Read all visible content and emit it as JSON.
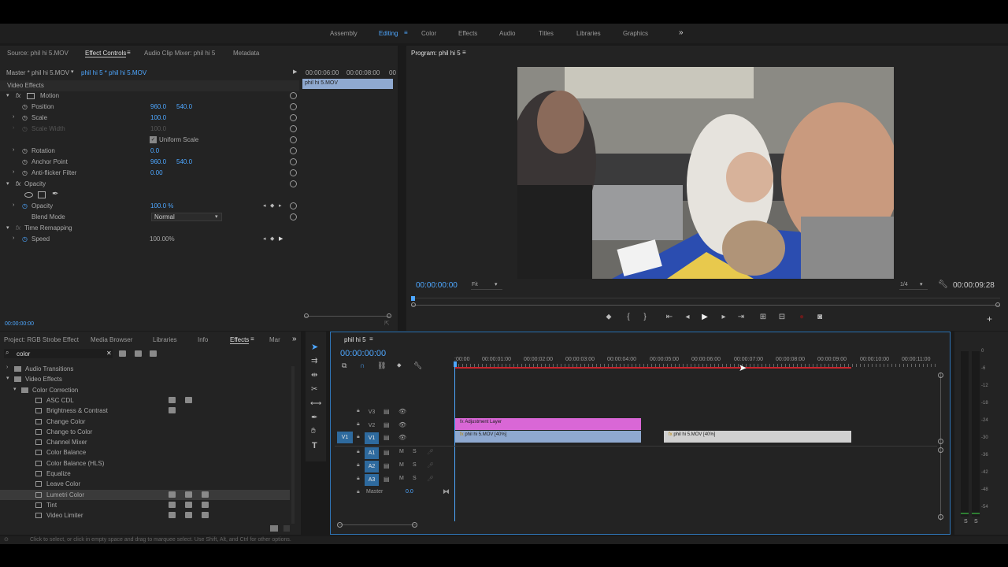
{
  "workspaces": {
    "items": [
      "Assembly",
      "Editing",
      "Color",
      "Effects",
      "Audio",
      "Titles",
      "Libraries",
      "Graphics"
    ],
    "active": "Editing",
    "more": "»"
  },
  "source_panel": {
    "tabs": [
      "Source: phil hi 5.MOV",
      "Effect Controls",
      "Audio Clip Mixer: phil hi 5",
      "Metadata"
    ],
    "master": "Master * phil hi 5.MOV",
    "sequence_clip": "phil hi 5 * phil hi 5.MOV",
    "ruler": [
      "00:00:06:00",
      "00:00:08:00",
      "00"
    ],
    "clip_label": "phil hi 5.MOV",
    "section": "Video Effects",
    "motion": "Motion",
    "position_label": "Position",
    "position_x": "960.0",
    "position_y": "540.0",
    "scale_label": "Scale",
    "scale": "100.0",
    "scale_width_label": "Scale Width",
    "scale_width": "100.0",
    "uniform_scale": "Uniform Scale",
    "rotation_label": "Rotation",
    "rotation": "0.0",
    "anchor_label": "Anchor Point",
    "anchor_x": "960.0",
    "anchor_y": "540.0",
    "antiflicker_label": "Anti-flicker Filter",
    "antiflicker": "0.00",
    "opacity_section": "Opacity",
    "opacity_label": "Opacity",
    "opacity": "100.0 %",
    "blend_label": "Blend Mode",
    "blend": "Normal",
    "time_remap": "Time Remapping",
    "speed_label": "Speed",
    "speed": "100.00%",
    "timecode": "00:00:00:00"
  },
  "program": {
    "title": "Program: phil hi 5",
    "timecode": "00:00:00:00",
    "fit": "Fit",
    "quality": "1/4",
    "duration": "00:00:09:28"
  },
  "project_panel": {
    "tabs": [
      "Project: RGB Strobe Effect",
      "Media Browser",
      "Libraries",
      "Info",
      "Effects",
      "Mar"
    ],
    "active_tab": "Effects",
    "more": "»",
    "search_value": "color",
    "tree": [
      {
        "label": "Audio Transitions",
        "type": "folder",
        "indent": 0,
        "expanded": false
      },
      {
        "label": "Video Effects",
        "type": "folder",
        "indent": 0,
        "expanded": true
      },
      {
        "label": "Color Correction",
        "type": "folder",
        "indent": 1,
        "expanded": true
      },
      {
        "label": "ASC CDL",
        "type": "fx",
        "indent": 2,
        "badges": 2
      },
      {
        "label": "Brightness & Contrast",
        "type": "fx",
        "indent": 2,
        "badges": 1
      },
      {
        "label": "Change Color",
        "type": "fx",
        "indent": 2,
        "badges": 0
      },
      {
        "label": "Change to Color",
        "type": "fx",
        "indent": 2,
        "badges": 0
      },
      {
        "label": "Channel Mixer",
        "type": "fx",
        "indent": 2,
        "badges": 0
      },
      {
        "label": "Color Balance",
        "type": "fx",
        "indent": 2,
        "badges": 0
      },
      {
        "label": "Color Balance (HLS)",
        "type": "fx",
        "indent": 2,
        "badges": 0
      },
      {
        "label": "Equalize",
        "type": "fx",
        "indent": 2,
        "badges": 0
      },
      {
        "label": "Leave Color",
        "type": "fx",
        "indent": 2,
        "badges": 0
      },
      {
        "label": "Lumetri Color",
        "type": "fx",
        "indent": 2,
        "badges": 3,
        "selected": true
      },
      {
        "label": "Tint",
        "type": "fx",
        "indent": 2,
        "badges": 3
      },
      {
        "label": "Video Limiter",
        "type": "fx",
        "indent": 2,
        "badges": 3
      }
    ]
  },
  "timeline": {
    "tab": "phil hi 5",
    "timecode": "00:00:00:00",
    "ruler": [
      ":00:00",
      "00:00:01:00",
      "00:00:02:00",
      "00:00:03:00",
      "00:00:04:00",
      "00:00:05:00",
      "00:00:06:00",
      "00:00:07:00",
      "00:00:08:00",
      "00:00:09:00",
      "00:00:10:00",
      "00:00:11:00"
    ],
    "video_tracks": [
      "V3",
      "V2",
      "V1"
    ],
    "audio_tracks": [
      "A1",
      "A2",
      "A3"
    ],
    "source_v": "V1",
    "source_a": "A1",
    "master_label": "Master",
    "master_value": "0.0",
    "clips": {
      "adjustment": "Adjustment Layer",
      "clip1": "phil hi 5.MOV [40%]",
      "clip2": "phil hi 5.MOV [40%]"
    },
    "track_buttons": {
      "m": "M",
      "s": "S"
    }
  },
  "meters": {
    "scale": [
      "0",
      "-6",
      "-12",
      "-18",
      "-24",
      "-30",
      "-36",
      "-42",
      "-48",
      "-54"
    ],
    "solo": [
      "S",
      "S"
    ]
  },
  "status": "Click to select, or click in empty space and drag to marquee select. Use Shift, Alt, and Ctrl for other options.",
  "colors": {
    "accent_blue": "#4ea7ff",
    "adjustment_clip": "#d967d6",
    "video_clip": "#8fa9d0",
    "clip2": "#d0d0d0",
    "render_bar": "#c8252c"
  }
}
